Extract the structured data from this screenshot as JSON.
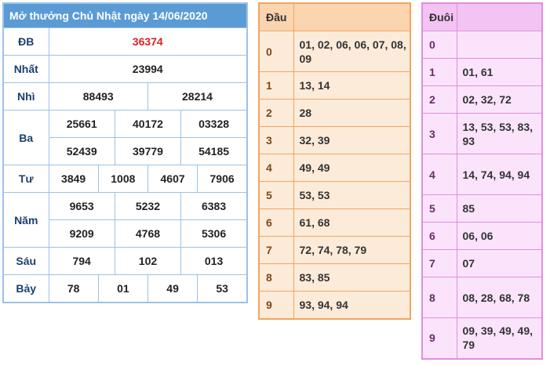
{
  "results": {
    "title": "Mở thưởng Chủ Nhật ngày 14/06/2020",
    "db_label": "ĐB",
    "db": "36374",
    "nhat_label": "Nhất",
    "nhat": "23994",
    "nhi_label": "Nhì",
    "nhi": [
      "88493",
      "28214"
    ],
    "ba_label": "Ba",
    "ba": [
      "25661",
      "40172",
      "03328",
      "52439",
      "39779",
      "54185"
    ],
    "tu_label": "Tư",
    "tu": [
      "3849",
      "1008",
      "4607",
      "7906"
    ],
    "nam_label": "Năm",
    "nam": [
      "9653",
      "5232",
      "6383",
      "9209",
      "4768",
      "5306"
    ],
    "sau_label": "Sáu",
    "sau": [
      "794",
      "102",
      "013"
    ],
    "bay_label": "Bảy",
    "bay": [
      "78",
      "01",
      "49",
      "53"
    ]
  },
  "dau": {
    "header": "Đầu",
    "rows": [
      {
        "k": "0",
        "v": "01, 02, 06, 06, 07, 08, 09"
      },
      {
        "k": "1",
        "v": "13, 14"
      },
      {
        "k": "2",
        "v": "28"
      },
      {
        "k": "3",
        "v": "32, 39"
      },
      {
        "k": "4",
        "v": "49, 49"
      },
      {
        "k": "5",
        "v": "53, 53"
      },
      {
        "k": "6",
        "v": "61, 68"
      },
      {
        "k": "7",
        "v": "72, 74, 78, 79"
      },
      {
        "k": "8",
        "v": "83, 85"
      },
      {
        "k": "9",
        "v": "93, 94, 94"
      }
    ]
  },
  "duoi": {
    "header": "Đuôi",
    "rows": [
      {
        "k": "0",
        "v": ""
      },
      {
        "k": "1",
        "v": "01, 61"
      },
      {
        "k": "2",
        "v": "02, 32, 72"
      },
      {
        "k": "3",
        "v": "13, 53, 53, 83, 93"
      },
      {
        "k": "4",
        "v": "14, 74, 94, 94"
      },
      {
        "k": "5",
        "v": "85"
      },
      {
        "k": "6",
        "v": "06, 06"
      },
      {
        "k": "7",
        "v": "07"
      },
      {
        "k": "8",
        "v": "08, 28, 68, 78"
      },
      {
        "k": "9",
        "v": "09, 39, 49, 49, 79"
      }
    ]
  }
}
